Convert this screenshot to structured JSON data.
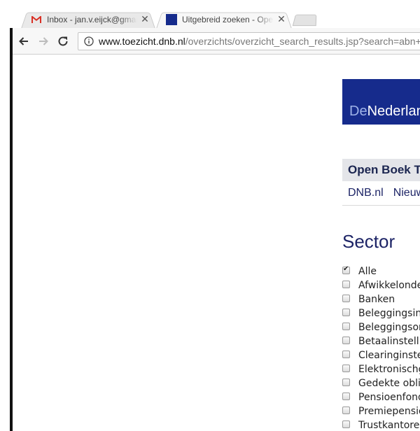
{
  "browser": {
    "tabs": [
      {
        "title": "Inbox - jan.v.eijck@gmail.com",
        "icon": "gmail-icon",
        "active": false
      },
      {
        "title": "Uitgebreid zoeken - Open Boek Toezicht",
        "icon": "dnb-favicon",
        "active": true
      }
    ],
    "close_glyph": "✕",
    "url_host": "www.toezicht.dnb.nl",
    "url_path": "/overzichts/overzicht_search_results.jsp?search=abn+amro"
  },
  "page": {
    "logo_prefix": "De",
    "logo_main": "Nederlandsche Bank",
    "section_bar": "Open Boek Toezicht",
    "subnav": [
      "DNB.nl",
      "Nieuws"
    ],
    "sector_heading": "Sector",
    "sectors": [
      {
        "label": "Alle",
        "checked": true
      },
      {
        "label": "Afwikkelondernemingen",
        "checked": false
      },
      {
        "label": "Banken",
        "checked": false
      },
      {
        "label": "Beleggingsinstellingen",
        "checked": false
      },
      {
        "label": "Beleggingsondernemingen",
        "checked": false
      },
      {
        "label": "Betaalinstellingen",
        "checked": false
      },
      {
        "label": "Clearinginstellingen",
        "checked": false
      },
      {
        "label": "Elektronischgeldinstellingen",
        "checked": false
      },
      {
        "label": "Gedekte obligaties",
        "checked": false
      },
      {
        "label": "Pensioenfondsen",
        "checked": false
      },
      {
        "label": "Premiepensioeninstellingen",
        "checked": false
      },
      {
        "label": "Trustkantoren",
        "checked": false
      }
    ]
  },
  "colors": {
    "dnb_blue": "#162b8c",
    "heading_navy": "#1d2466",
    "gmail_red": "#d93025"
  }
}
